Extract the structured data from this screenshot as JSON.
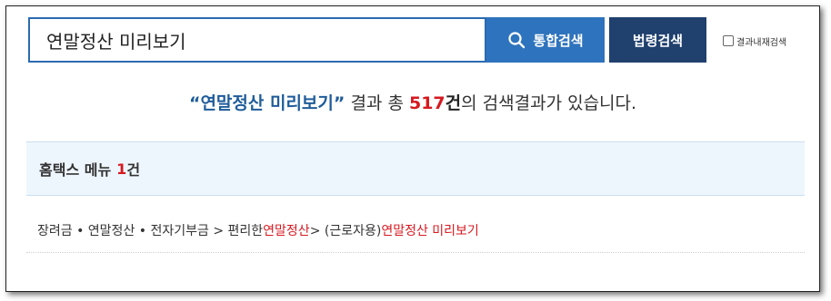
{
  "search": {
    "query": "연말정산 미리보기",
    "integrated_button": "통합검색",
    "law_button": "법령검색",
    "within_results_label": "결과내재검색"
  },
  "summary": {
    "quote_open": "“",
    "query": "연말정산 미리보기",
    "quote_close": "”",
    "text_before_count": " 결과 총 ",
    "count": "517",
    "count_unit": "건",
    "text_after_count": "의 검색결과가 있습니다."
  },
  "category": {
    "name": "홈택스 메뉴",
    "count": "1",
    "count_unit": "건"
  },
  "results": [
    {
      "part1": "장려금 • 연말정산 • 전자기부금 > 편리한",
      "highlight1": "연말정산",
      "part2": " > (근로자용) ",
      "highlight2": "연말정산 미리보기"
    }
  ],
  "colors": {
    "primary_blue": "#2e73bd",
    "dark_navy": "#20406e",
    "highlight_red": "#d71920",
    "header_bg": "#eef6fd"
  },
  "icons": {
    "search_button_icon": "magnifier"
  }
}
